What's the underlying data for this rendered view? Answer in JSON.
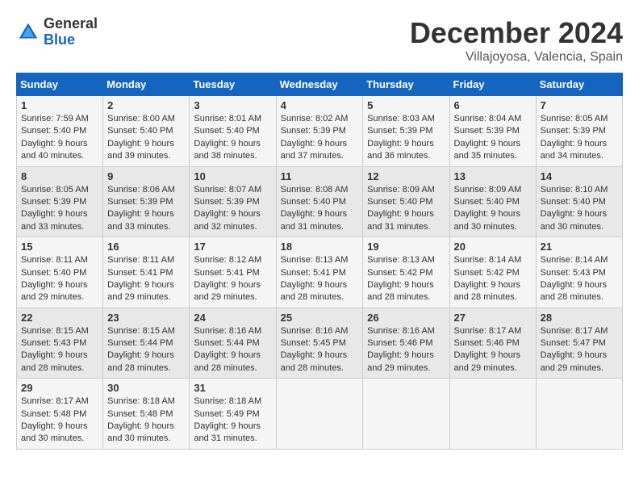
{
  "header": {
    "logo_general": "General",
    "logo_blue": "Blue",
    "month_title": "December 2024",
    "location": "Villajoyosa, Valencia, Spain"
  },
  "columns": [
    "Sunday",
    "Monday",
    "Tuesday",
    "Wednesday",
    "Thursday",
    "Friday",
    "Saturday"
  ],
  "weeks": [
    {
      "days": [
        {
          "num": "1",
          "sunrise": "Sunrise: 7:59 AM",
          "sunset": "Sunset: 5:40 PM",
          "daylight": "Daylight: 9 hours and 40 minutes."
        },
        {
          "num": "2",
          "sunrise": "Sunrise: 8:00 AM",
          "sunset": "Sunset: 5:40 PM",
          "daylight": "Daylight: 9 hours and 39 minutes."
        },
        {
          "num": "3",
          "sunrise": "Sunrise: 8:01 AM",
          "sunset": "Sunset: 5:40 PM",
          "daylight": "Daylight: 9 hours and 38 minutes."
        },
        {
          "num": "4",
          "sunrise": "Sunrise: 8:02 AM",
          "sunset": "Sunset: 5:39 PM",
          "daylight": "Daylight: 9 hours and 37 minutes."
        },
        {
          "num": "5",
          "sunrise": "Sunrise: 8:03 AM",
          "sunset": "Sunset: 5:39 PM",
          "daylight": "Daylight: 9 hours and 36 minutes."
        },
        {
          "num": "6",
          "sunrise": "Sunrise: 8:04 AM",
          "sunset": "Sunset: 5:39 PM",
          "daylight": "Daylight: 9 hours and 35 minutes."
        },
        {
          "num": "7",
          "sunrise": "Sunrise: 8:05 AM",
          "sunset": "Sunset: 5:39 PM",
          "daylight": "Daylight: 9 hours and 34 minutes."
        }
      ]
    },
    {
      "days": [
        {
          "num": "8",
          "sunrise": "Sunrise: 8:05 AM",
          "sunset": "Sunset: 5:39 PM",
          "daylight": "Daylight: 9 hours and 33 minutes."
        },
        {
          "num": "9",
          "sunrise": "Sunrise: 8:06 AM",
          "sunset": "Sunset: 5:39 PM",
          "daylight": "Daylight: 9 hours and 33 minutes."
        },
        {
          "num": "10",
          "sunrise": "Sunrise: 8:07 AM",
          "sunset": "Sunset: 5:39 PM",
          "daylight": "Daylight: 9 hours and 32 minutes."
        },
        {
          "num": "11",
          "sunrise": "Sunrise: 8:08 AM",
          "sunset": "Sunset: 5:40 PM",
          "daylight": "Daylight: 9 hours and 31 minutes."
        },
        {
          "num": "12",
          "sunrise": "Sunrise: 8:09 AM",
          "sunset": "Sunset: 5:40 PM",
          "daylight": "Daylight: 9 hours and 31 minutes."
        },
        {
          "num": "13",
          "sunrise": "Sunrise: 8:09 AM",
          "sunset": "Sunset: 5:40 PM",
          "daylight": "Daylight: 9 hours and 30 minutes."
        },
        {
          "num": "14",
          "sunrise": "Sunrise: 8:10 AM",
          "sunset": "Sunset: 5:40 PM",
          "daylight": "Daylight: 9 hours and 30 minutes."
        }
      ]
    },
    {
      "days": [
        {
          "num": "15",
          "sunrise": "Sunrise: 8:11 AM",
          "sunset": "Sunset: 5:40 PM",
          "daylight": "Daylight: 9 hours and 29 minutes."
        },
        {
          "num": "16",
          "sunrise": "Sunrise: 8:11 AM",
          "sunset": "Sunset: 5:41 PM",
          "daylight": "Daylight: 9 hours and 29 minutes."
        },
        {
          "num": "17",
          "sunrise": "Sunrise: 8:12 AM",
          "sunset": "Sunset: 5:41 PM",
          "daylight": "Daylight: 9 hours and 29 minutes."
        },
        {
          "num": "18",
          "sunrise": "Sunrise: 8:13 AM",
          "sunset": "Sunset: 5:41 PM",
          "daylight": "Daylight: 9 hours and 28 minutes."
        },
        {
          "num": "19",
          "sunrise": "Sunrise: 8:13 AM",
          "sunset": "Sunset: 5:42 PM",
          "daylight": "Daylight: 9 hours and 28 minutes."
        },
        {
          "num": "20",
          "sunrise": "Sunrise: 8:14 AM",
          "sunset": "Sunset: 5:42 PM",
          "daylight": "Daylight: 9 hours and 28 minutes."
        },
        {
          "num": "21",
          "sunrise": "Sunrise: 8:14 AM",
          "sunset": "Sunset: 5:43 PM",
          "daylight": "Daylight: 9 hours and 28 minutes."
        }
      ]
    },
    {
      "days": [
        {
          "num": "22",
          "sunrise": "Sunrise: 8:15 AM",
          "sunset": "Sunset: 5:43 PM",
          "daylight": "Daylight: 9 hours and 28 minutes."
        },
        {
          "num": "23",
          "sunrise": "Sunrise: 8:15 AM",
          "sunset": "Sunset: 5:44 PM",
          "daylight": "Daylight: 9 hours and 28 minutes."
        },
        {
          "num": "24",
          "sunrise": "Sunrise: 8:16 AM",
          "sunset": "Sunset: 5:44 PM",
          "daylight": "Daylight: 9 hours and 28 minutes."
        },
        {
          "num": "25",
          "sunrise": "Sunrise: 8:16 AM",
          "sunset": "Sunset: 5:45 PM",
          "daylight": "Daylight: 9 hours and 28 minutes."
        },
        {
          "num": "26",
          "sunrise": "Sunrise: 8:16 AM",
          "sunset": "Sunset: 5:46 PM",
          "daylight": "Daylight: 9 hours and 29 minutes."
        },
        {
          "num": "27",
          "sunrise": "Sunrise: 8:17 AM",
          "sunset": "Sunset: 5:46 PM",
          "daylight": "Daylight: 9 hours and 29 minutes."
        },
        {
          "num": "28",
          "sunrise": "Sunrise: 8:17 AM",
          "sunset": "Sunset: 5:47 PM",
          "daylight": "Daylight: 9 hours and 29 minutes."
        }
      ]
    },
    {
      "days": [
        {
          "num": "29",
          "sunrise": "Sunrise: 8:17 AM",
          "sunset": "Sunset: 5:48 PM",
          "daylight": "Daylight: 9 hours and 30 minutes."
        },
        {
          "num": "30",
          "sunrise": "Sunrise: 8:18 AM",
          "sunset": "Sunset: 5:48 PM",
          "daylight": "Daylight: 9 hours and 30 minutes."
        },
        {
          "num": "31",
          "sunrise": "Sunrise: 8:18 AM",
          "sunset": "Sunset: 5:49 PM",
          "daylight": "Daylight: 9 hours and 31 minutes."
        },
        null,
        null,
        null,
        null
      ]
    }
  ]
}
